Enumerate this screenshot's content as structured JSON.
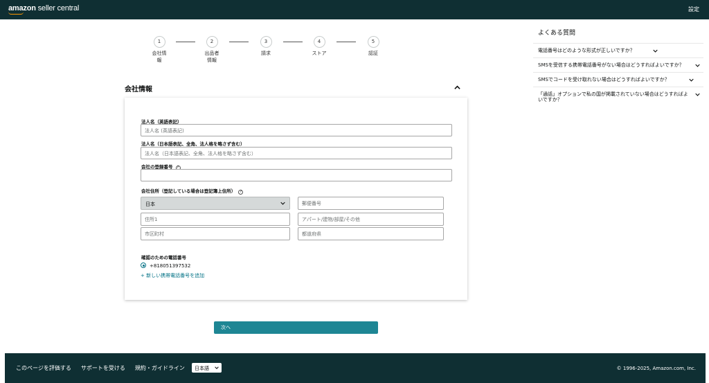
{
  "header": {
    "logo_bold": "amazon",
    "logo_rest": " seller central",
    "settings": "設定"
  },
  "steps": [
    {
      "num": "1",
      "label": "会社情\n報"
    },
    {
      "num": "2",
      "label": "出品者\n情報"
    },
    {
      "num": "3",
      "label": "請求"
    },
    {
      "num": "4",
      "label": "ストア"
    },
    {
      "num": "5",
      "label": "認証"
    }
  ],
  "section": {
    "title": "会社情報"
  },
  "form": {
    "legal_name_en_label": "法人名（英語表記）",
    "legal_name_en_placeholder": "法人名 (英語表記)",
    "legal_name_ja_label": "法人名（日本語表記、全角、法人格を略さず含む）",
    "legal_name_ja_placeholder": "法人名（日本語表記、全角、法人格を略さず含む）",
    "reg_number_label": "会社の登録番号",
    "reg_number_value": "",
    "address_label": "会社住所（登記している場合は登記簿上住所）",
    "country_value": "日本",
    "postal_placeholder": "郵便番号",
    "address1_placeholder": "住所1",
    "address2_placeholder": "アパート/建物/部屋/その他",
    "city_placeholder": "市区町村",
    "prefecture_placeholder": "都道府県",
    "phone_label": "確認のための電話番号",
    "phone_value": "+818051397532",
    "add_phone_link": "+ 新しい携帯電話番号を追加"
  },
  "next_button": "次へ",
  "faq": {
    "title": "よくある質問",
    "items": [
      "電話番号はどのような形式が正しいですか？",
      "SMSを受信する携帯電話番号がない場合はどうすればよいですか？",
      "SMSでコードを受け取れない場合はどうすればよいですか？",
      "「通話」オプションで私の国が掲載されていない場合はどうすればよいですか？"
    ]
  },
  "footer": {
    "rate_page": "このページを評価する",
    "support": "サポートを受ける",
    "policies": "規約・ガイドライン",
    "language": "日本語",
    "copyright": "© 1996-2025, Amazon.com, Inc."
  }
}
